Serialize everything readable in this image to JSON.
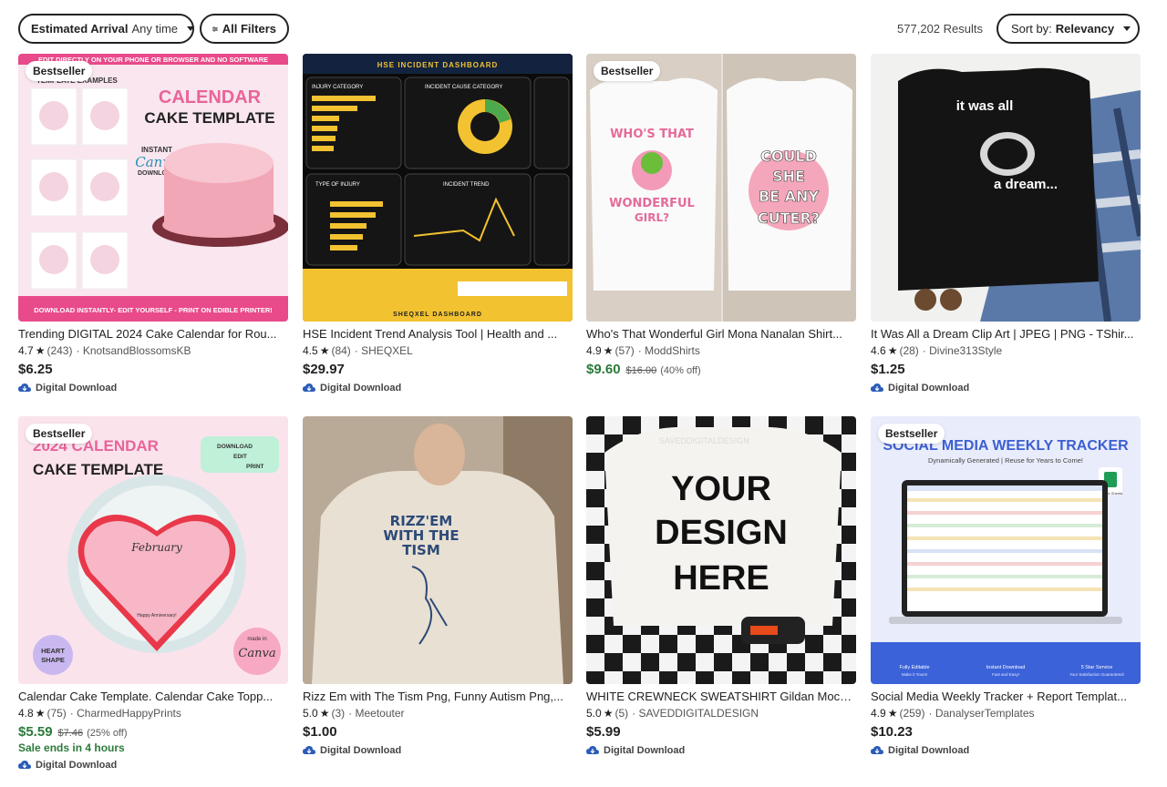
{
  "filters": {
    "arrival_label": "Estimated Arrival",
    "arrival_value": "Any time",
    "all_filters_label": "All Filters",
    "results_text": "577,202 Results",
    "sort_label": "Sort by:",
    "sort_value": "Relevancy"
  },
  "listings": [
    {
      "badge": "Bestseller",
      "title": "Trending DIGITAL 2024 Cake Calendar for Rou...",
      "rating": "4.7",
      "reviews": "(243)",
      "shop": "KnotsandBlossomsKB",
      "price": "$6.25",
      "download": "Digital Download",
      "image": {
        "header": "EDIT DIRECTLY ON YOUR PHONE OR BROWSER AND NO SOFTWARE",
        "sub": "TEMPLATE EXAMPLES",
        "line1": "CALENDAR",
        "line2": "CAKE TEMPLATE",
        "tag1": "INSTANT",
        "tag2": "Canva",
        "tag3": "DOWNLOAD",
        "footer": "DOWNLOAD INSTANTLY- EDIT YOURSELF - PRINT ON EDIBLE PRINTER!"
      }
    },
    {
      "badge": "",
      "title": "HSE Incident Trend Analysis Tool | Health and ...",
      "rating": "4.5",
      "reviews": "(84)",
      "shop": "SHEQXEL",
      "price": "$29.97",
      "download": "Digital Download",
      "image": {
        "header": "HSE INCIDENT DASHBOARD",
        "panel1": "INJURY CATEGORY",
        "panel2": "INCIDENT CAUSE CATEGORY",
        "panel3": "TYPE OF INJURY",
        "panel4": "INCIDENT TREND",
        "footer": "SHEQXEL DASHBOARD"
      }
    },
    {
      "badge": "Bestseller",
      "title": "Who's That Wonderful Girl Mona Nanalan Shirt...",
      "rating": "4.9",
      "reviews": "(57)",
      "shop": "ModdShirts",
      "price": "$9.60",
      "orig_price": "$16.00",
      "discount": "(40% off)",
      "download": "",
      "image": {
        "left_l1": "WHO'S THAT",
        "left_l2": "WONDERFUL",
        "left_l3": "GIRL?",
        "right_l1": "COULD",
        "right_l2": "SHE",
        "right_l3": "BE ANY",
        "right_l4": "CUTER?"
      }
    },
    {
      "badge": "",
      "title": "It Was All a Dream Clip Art | JPEG | PNG - TShir...",
      "rating": "4.6",
      "reviews": "(28)",
      "shop": "Divine313Style",
      "price": "$1.25",
      "download": "Digital Download",
      "image": {
        "line1": "it was all",
        "line2": "a dream..."
      }
    },
    {
      "badge": "Bestseller",
      "title": "Calendar Cake Template. Calendar Cake Topp...",
      "rating": "4.8",
      "reviews": "(75)",
      "shop": "CharmedHappyPrints",
      "price": "$5.59",
      "orig_price": "$7.46",
      "discount": "(25% off)",
      "sale_ends": "Sale ends in 4 hours",
      "download": "Digital Download",
      "image": {
        "line1": "2024 CALENDAR",
        "line2": "CAKE TEMPLATE",
        "opt1": "DOWNLOAD",
        "opt2": "EDIT",
        "opt3": "PRINT",
        "month": "February",
        "heart1": "HEART",
        "heart2": "SHAPE",
        "brand1": "made in",
        "brand2": "Canva",
        "note": "Happy Anniversary!"
      }
    },
    {
      "badge": "",
      "title": "Rizz Em with The Tism Png, Funny Autism Png,...",
      "rating": "5.0",
      "reviews": "(3)",
      "shop": "Meetouter",
      "price": "$1.00",
      "download": "Digital Download",
      "image": {
        "line1": "RIZZ'EM",
        "line2": "WITH THE",
        "line3": "TISM"
      }
    },
    {
      "badge": "",
      "title": "WHITE CREWNECK SWEATSHIRT Gildan Mock ...",
      "rating": "5.0",
      "reviews": "(5)",
      "shop": "SAVEDDIGITALDESIGN",
      "price": "$5.99",
      "download": "Digital Download",
      "image": {
        "line1": "YOUR",
        "line2": "DESIGN",
        "line3": "HERE",
        "watermark": "SAVEDDIGITALDESIGN"
      }
    },
    {
      "badge": "Bestseller",
      "title": "Social Media Weekly Tracker + Report Templat...",
      "rating": "4.9",
      "reviews": "(259)",
      "shop": "DanalyserTemplates",
      "price": "$10.23",
      "download": "Digital Download",
      "image": {
        "headline": "SOCIAL MEDIA WEEKLY TRACKER",
        "subhead": "Dynamically Generated | Reuse for Years to Come!",
        "sheets": "Google Sheets",
        "f1a": "Fully Editable",
        "f1b": "Make it Yours!",
        "f2a": "Instant Download",
        "f2b": "Fast and Easy!",
        "f3a": "5 Star Service",
        "f3b": "Your Satisfaction Guaranteed!"
      }
    }
  ],
  "colors": {
    "sale_green": "#2b7a3a",
    "star": "#222222",
    "cloud_icon": "#2a5cb8"
  },
  "icons": {
    "star": "star-icon",
    "download": "cloud-download-icon",
    "filter": "sliders-icon",
    "caret": "caret-down-icon"
  }
}
